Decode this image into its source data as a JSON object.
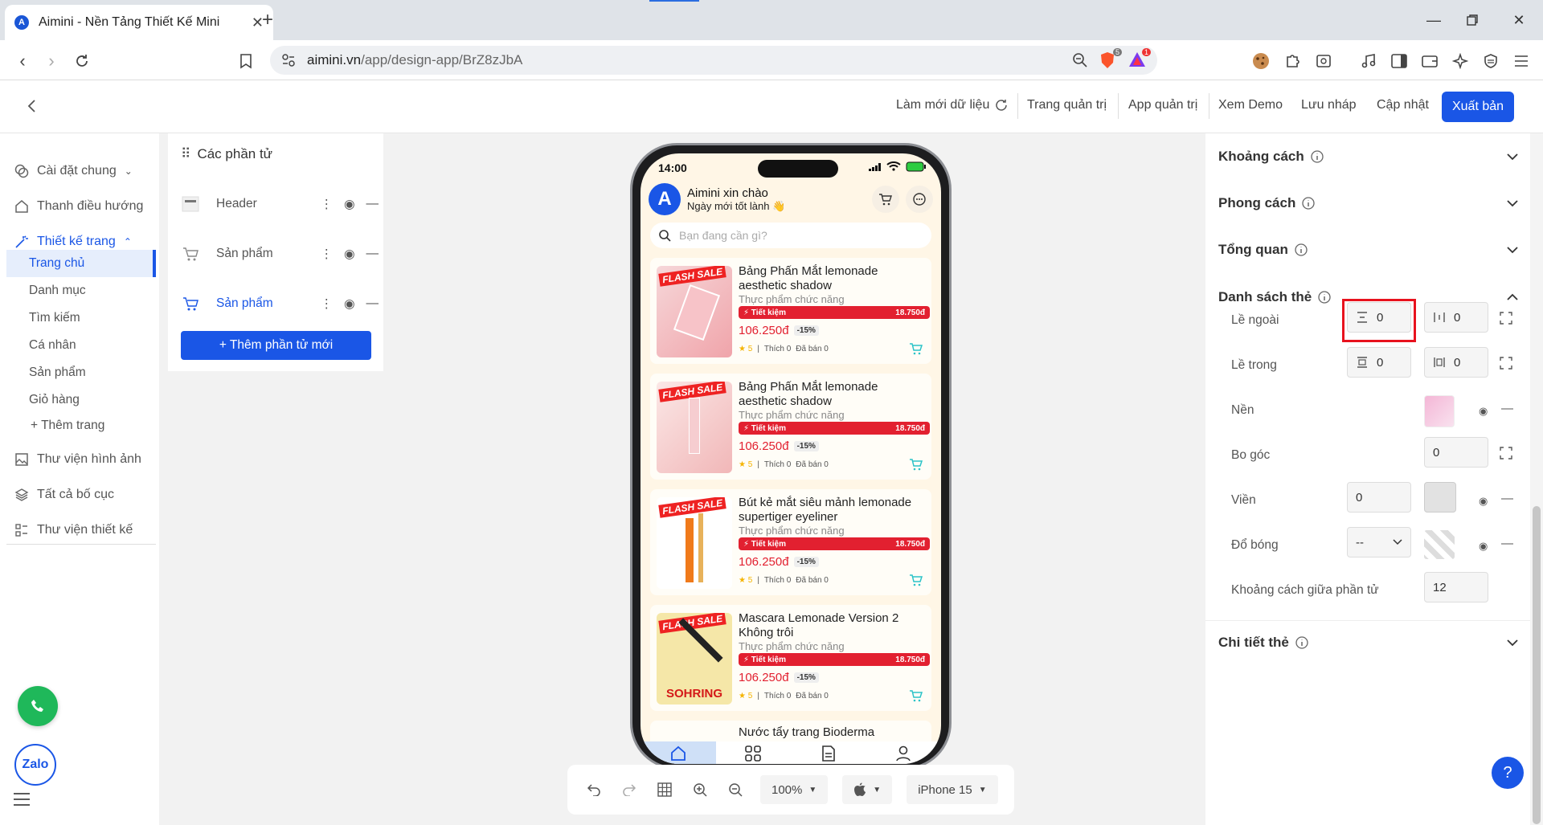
{
  "browser": {
    "tab_title": "Aimini - Nền Tảng Thiết Kế Mini",
    "tab_favicon": "A",
    "url_host": "aimini.vn",
    "url_path": "/app/design-app/BrZ8zJbA",
    "brave_badge": "5",
    "alert_badge": "1"
  },
  "header": {
    "refresh_label": "Làm mới dữ liệu",
    "admin_label": "Trang quản trị",
    "app_admin_label": "App quản trị",
    "demo_label": "Xem Demo",
    "draft_label": "Lưu nháp",
    "update_label": "Cập nhật",
    "publish_label": "Xuất bản"
  },
  "sidebar": {
    "general_settings": "Cài đặt chung",
    "navigation": "Thanh điều hướng",
    "page_design": "Thiết kế trang",
    "pages": [
      "Trang chủ",
      "Danh mục",
      "Tìm kiếm",
      "Cá nhân",
      "Sản phẩm",
      "Giỏ hàng"
    ],
    "add_page": "+ Thêm trang",
    "image_library": "Thư viện hình ảnh",
    "all_layouts": "Tất cả bố cục",
    "design_library": "Thư viện thiết kế",
    "zalo": "Zalo"
  },
  "elements_panel": {
    "title": "Các phần tử",
    "items": [
      "Header",
      "Sản phẩm",
      "Sản phẩm"
    ],
    "add_button": "+ Thêm phần tử mới"
  },
  "phone": {
    "time": "14:00",
    "avatar_letter": "A",
    "greeting": "Aimini xin chào",
    "subgreeting": "Ngày mới tốt lành 👋",
    "search_placeholder": "Bạn đang cần gì?",
    "flash_label": "FLASH SALE",
    "save_label": "⚡ Tiết kiệm",
    "stars_label": "★ 5",
    "likes_label": "Thích 0",
    "sold_label": "Đã bán 0",
    "products": [
      {
        "name": "Bảng Phấn Mắt lemonade aesthetic shadow",
        "category": "Thực phẩm chức năng",
        "saving": "18.750đ",
        "price": "106.250đ",
        "discount": "-15%"
      },
      {
        "name": "Bảng Phấn Mắt lemonade aesthetic shadow",
        "category": "Thực phẩm chức năng",
        "saving": "18.750đ",
        "price": "106.250đ",
        "discount": "-15%"
      },
      {
        "name": "Bút kẻ mắt siêu mảnh lemonade supertiger eyeliner",
        "category": "Thực phẩm chức năng",
        "saving": "18.750đ",
        "price": "106.250đ",
        "discount": "-15%"
      },
      {
        "name": "Mascara Lemonade Version 2 Không trôi",
        "category": "Thực phẩm chức năng",
        "saving": "18.750đ",
        "price": "106.250đ",
        "discount": "-15%"
      }
    ],
    "next_product_partial": "Nước tẩy trang Bioderma",
    "brand_text": "SOHRING"
  },
  "canvas_tools": {
    "zoom": "100%",
    "device": "iPhone 15"
  },
  "right_panel": {
    "sections": {
      "spacing": "Khoảng cách",
      "style": "Phong cách",
      "overview": "Tổng quan",
      "card_list": "Danh sách thẻ",
      "card_detail": "Chi tiết thẻ"
    },
    "props": {
      "margin_label": "Lề ngoài",
      "margin_v": "0",
      "margin_h": "0",
      "padding_label": "Lề trong",
      "padding_v": "0",
      "padding_h": "0",
      "background_label": "Nền",
      "radius_label": "Bo góc",
      "radius": "0",
      "border_label": "Viền",
      "border": "0",
      "shadow_label": "Đổ bóng",
      "shadow": "--",
      "gap_label": "Khoảng cách giữa phần tử",
      "gap": "12"
    }
  },
  "help": "?",
  "colors": {
    "accent": "#1a56e6",
    "sale": "#e22030",
    "highlight": "#e8121e"
  }
}
